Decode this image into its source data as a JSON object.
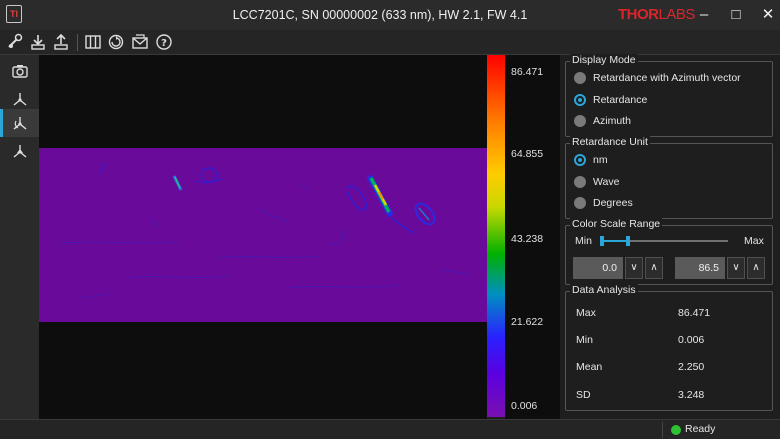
{
  "window": {
    "title": "LCC7201C, SN 00000002 (633 nm), HW 2.1, FW 4.1",
    "brand_bold": "THOR",
    "brand_light": "LABS"
  },
  "toolbar": {
    "icons": [
      "settings-icon",
      "save-download-icon",
      "export-icon",
      "grid-icon",
      "refresh-icon",
      "email-icon",
      "help-icon"
    ]
  },
  "sidebar": {
    "items": [
      "camera-icon",
      "axes-icon",
      "axes-rotated-icon",
      "axes-3d-icon"
    ],
    "active_index": 2
  },
  "colorbar": {
    "labels": [
      "86.471",
      "64.855",
      "43.238",
      "21.622",
      "0.006"
    ]
  },
  "display_mode": {
    "title": "Display Mode",
    "options": [
      "Retardance with Azimuth vector",
      "Retardance",
      "Azimuth"
    ],
    "selected": "Retardance"
  },
  "retardance_unit": {
    "title": "Retardance Unit",
    "options": [
      "nm",
      "Wave",
      "Degrees"
    ],
    "selected": "nm"
  },
  "color_scale": {
    "title": "Color Scale Range",
    "min_label": "Min",
    "max_label": "Max",
    "min_value": "0.0",
    "max_value": "86.5"
  },
  "data_analysis": {
    "title": "Data Analysis",
    "rows": [
      {
        "label": "Max",
        "value": "86.471"
      },
      {
        "label": "Min",
        "value": "0.006"
      },
      {
        "label": "Mean",
        "value": "2.250"
      },
      {
        "label": "SD",
        "value": "3.248"
      }
    ]
  },
  "status": {
    "text": "Ready",
    "color": "#2fc232"
  },
  "colors": {
    "accent": "#2ba6d9",
    "image_base": "#6a0a9a",
    "brand": "#d9262b"
  }
}
